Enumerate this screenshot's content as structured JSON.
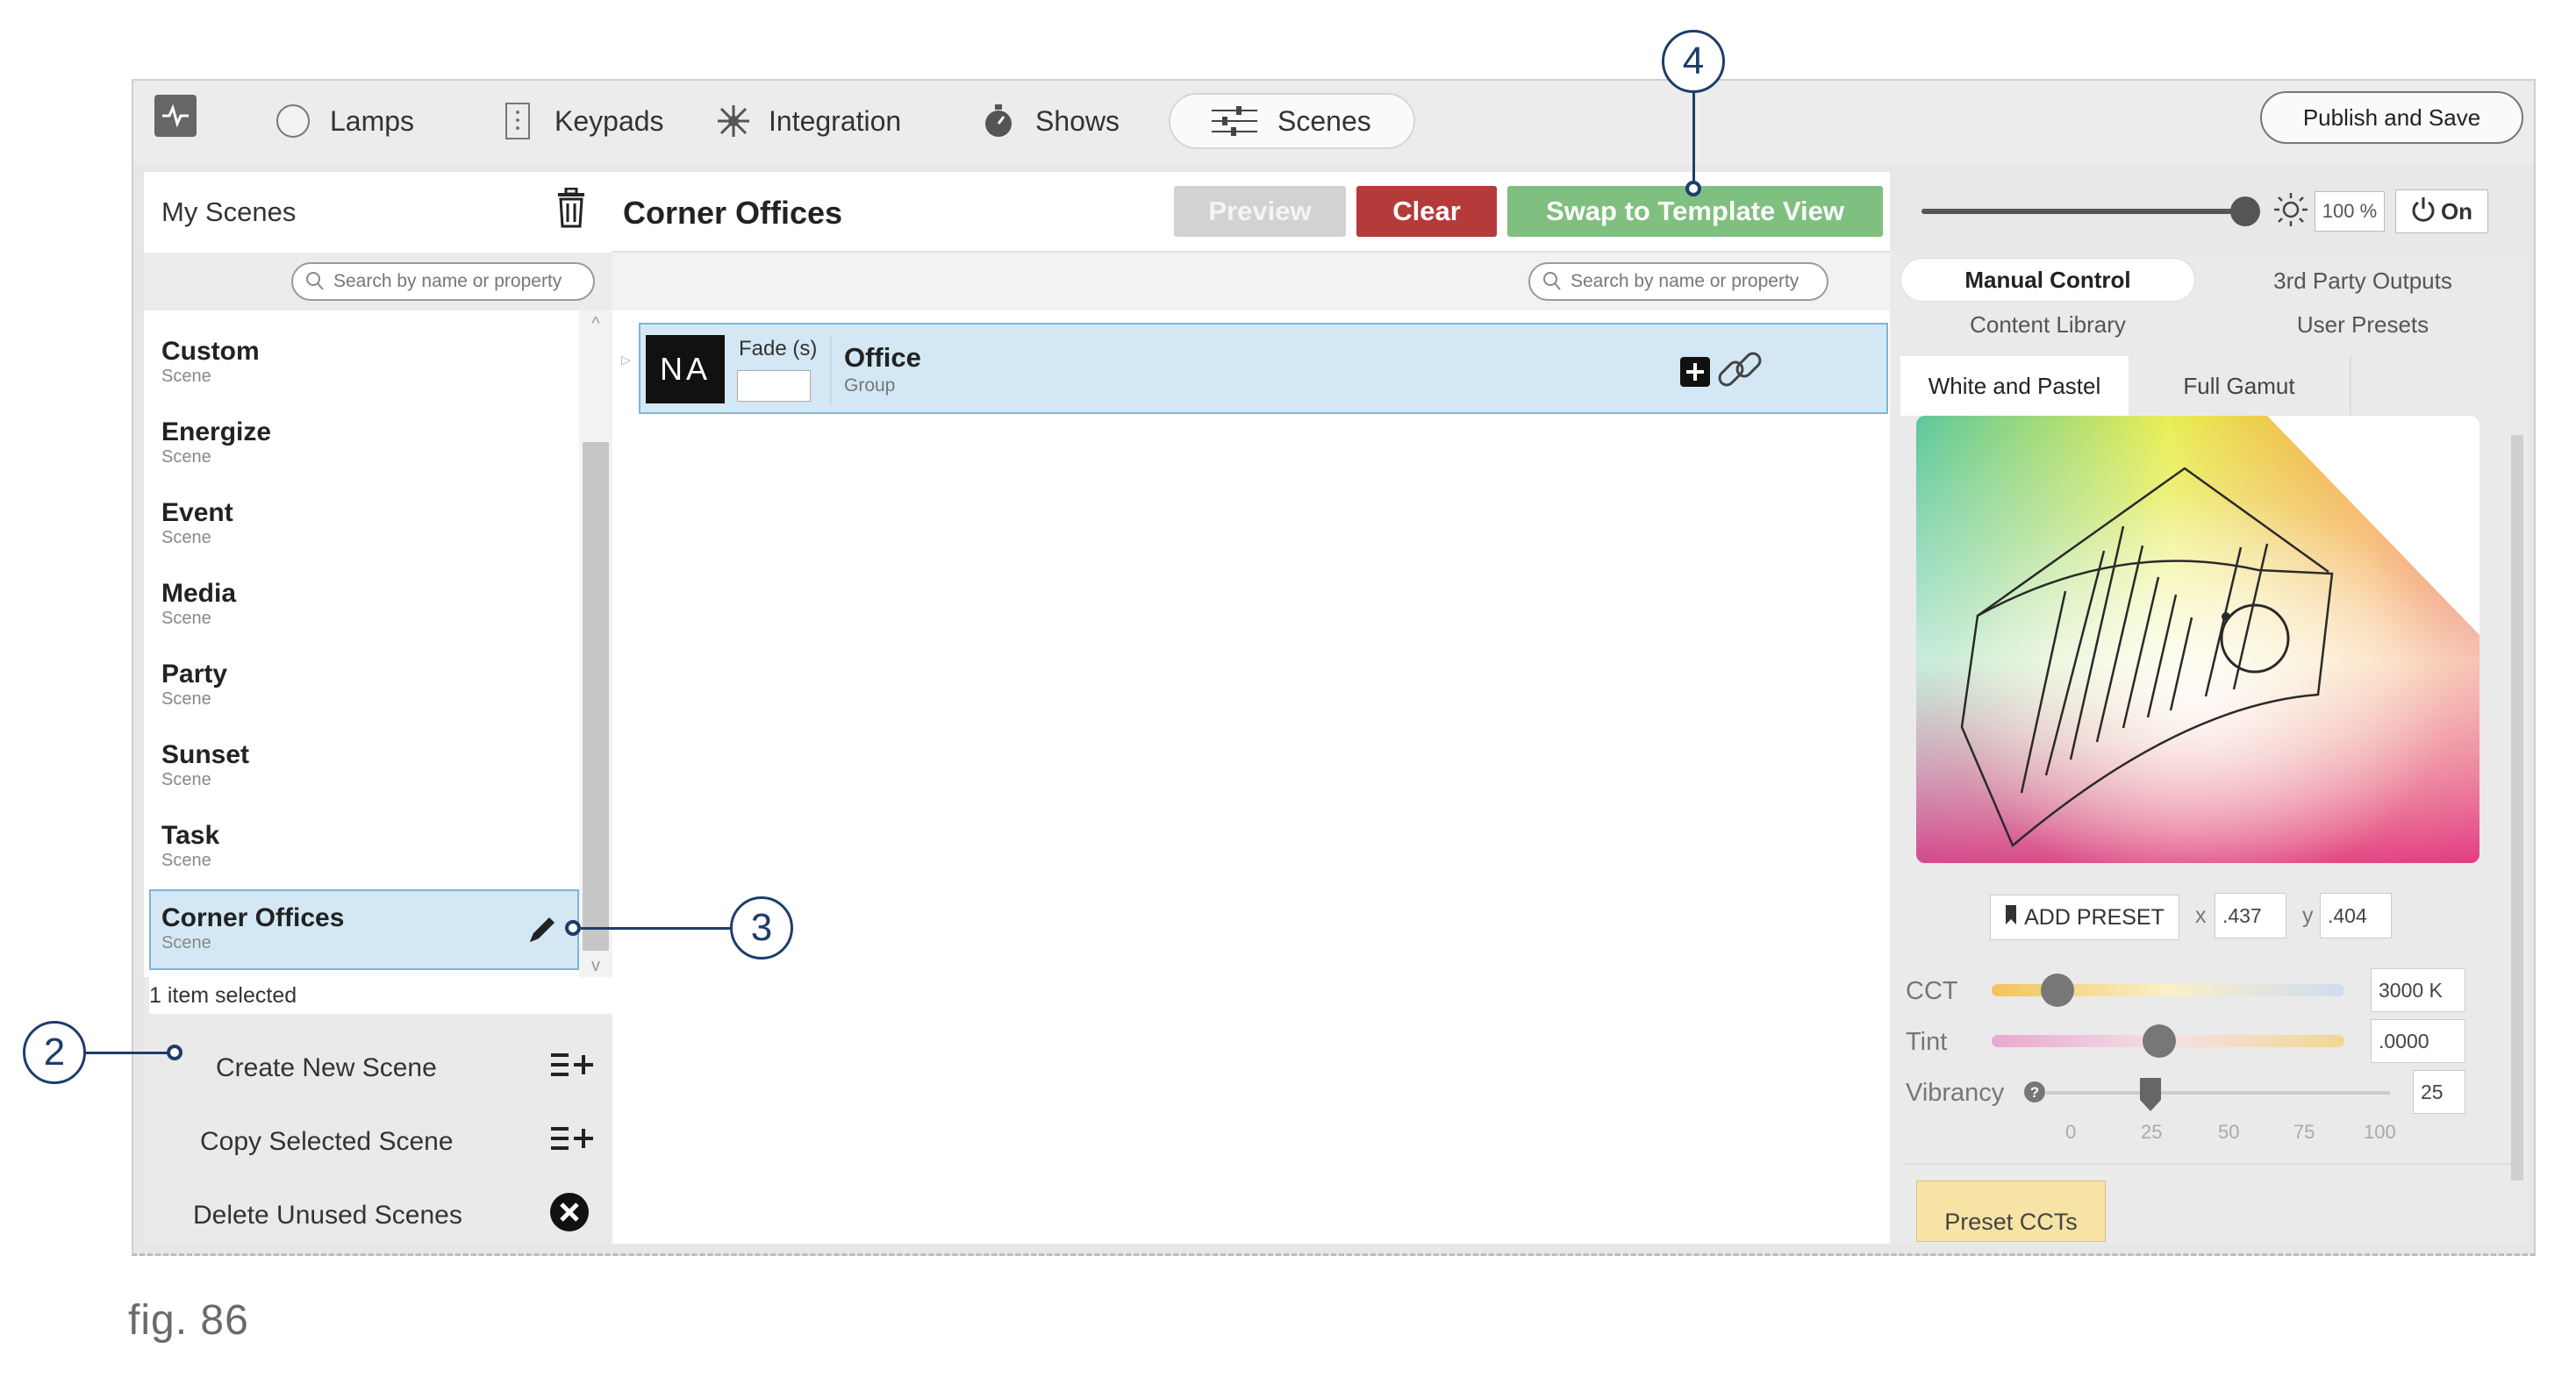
{
  "nav": {
    "items": [
      {
        "label": "Lamps",
        "icon": "circle-lamp-icon"
      },
      {
        "label": "Keypads",
        "icon": "keypad-icon"
      },
      {
        "label": "Integration",
        "icon": "integration-icon"
      },
      {
        "label": "Shows",
        "icon": "stopwatch-icon"
      },
      {
        "label": "Scenes",
        "icon": "sliders-icon"
      }
    ],
    "active": "Scenes",
    "publish_label": "Publish and Save"
  },
  "left": {
    "title": "My Scenes",
    "search_placeholder": "Search by name or property",
    "scenes": [
      {
        "name": "Custom",
        "type": "Scene"
      },
      {
        "name": "Energize",
        "type": "Scene"
      },
      {
        "name": "Event",
        "type": "Scene"
      },
      {
        "name": "Media",
        "type": "Scene"
      },
      {
        "name": "Party",
        "type": "Scene"
      },
      {
        "name": "Sunset",
        "type": "Scene"
      },
      {
        "name": "Task",
        "type": "Scene"
      },
      {
        "name": "Corner Offices",
        "type": "Scene"
      }
    ],
    "selected_scene": "Corner Offices",
    "selected_count": "1 item selected",
    "actions": {
      "create": "Create New Scene",
      "copy": "Copy Selected Scene",
      "delete": "Delete Unused Scenes"
    }
  },
  "middle": {
    "title": "Corner Offices",
    "preview_label": "Preview",
    "clear_label": "Clear",
    "swap_label": "Swap to Template View",
    "search_placeholder": "Search by name or property",
    "group": {
      "badge": "NA",
      "fade_label": "Fade (s)",
      "fade_value": "",
      "name": "Office",
      "type": "Group"
    }
  },
  "right": {
    "brightness_percent": 100,
    "brightness_text": "100 %",
    "power_label": "On",
    "tabs": [
      "Manual Control",
      "3rd Party Outputs",
      "Content Library",
      "User Presets"
    ],
    "active_tab": "Manual Control",
    "gamut_tabs": [
      "White and Pastel",
      "Full Gamut"
    ],
    "active_gamut_tab": "White and Pastel",
    "add_preset_label": "ADD PRESET",
    "x_label": "x",
    "x_value": ".437",
    "y_label": "y",
    "y_value": ".404",
    "cct_label": "CCT",
    "cct_value": "3000 K",
    "tint_label": "Tint",
    "tint_value": ".0000",
    "vibrancy_label": "Vibrancy",
    "vibrancy_value": "25",
    "vibrancy_ticks": [
      "0",
      "25",
      "50",
      "75",
      "100"
    ],
    "preset_ccts_label": "Preset CCTs",
    "colors": {
      "accent_green": "#7fbf7f",
      "clear_red": "#b53a3a",
      "selection_blue": "#d3e8f4"
    }
  },
  "callouts": [
    "2",
    "3",
    "4"
  ],
  "caption": "fig. 86"
}
